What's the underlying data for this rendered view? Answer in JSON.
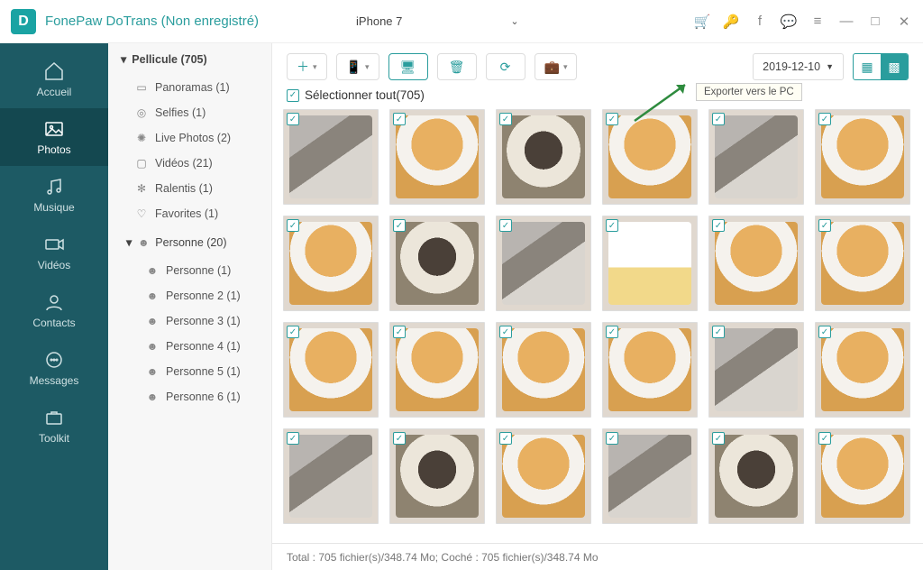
{
  "app_title": "FonePaw DoTrans (Non enregistré)",
  "device": "iPhone 7",
  "nav": {
    "home": "Accueil",
    "photos": "Photos",
    "music": "Musique",
    "videos": "Vidéos",
    "contacts": "Contacts",
    "messages": "Messages",
    "toolkit": "Toolkit"
  },
  "tree": {
    "root": "Pellicule (705)",
    "items": [
      "Panoramas (1)",
      "Selfies (1)",
      "Live Photos (2)",
      "Vidéos (21)",
      "Ralentis (1)",
      "Favorites (1)"
    ],
    "person_root": "Personne (20)",
    "persons": [
      "Personne (1)",
      "Personne 2 (1)",
      "Personne 3 (1)",
      "Personne 4 (1)",
      "Personne 5 (1)",
      "Personne 6 (1)"
    ]
  },
  "toolbar": {
    "date": "2019-12-10",
    "tooltip": "Exporter vers le PC"
  },
  "select_all": "Sélectionner tout(705)",
  "status": "Total : 705 fichier(s)/348.74 Mo; Coché : 705 fichier(s)/348.74 Mo"
}
